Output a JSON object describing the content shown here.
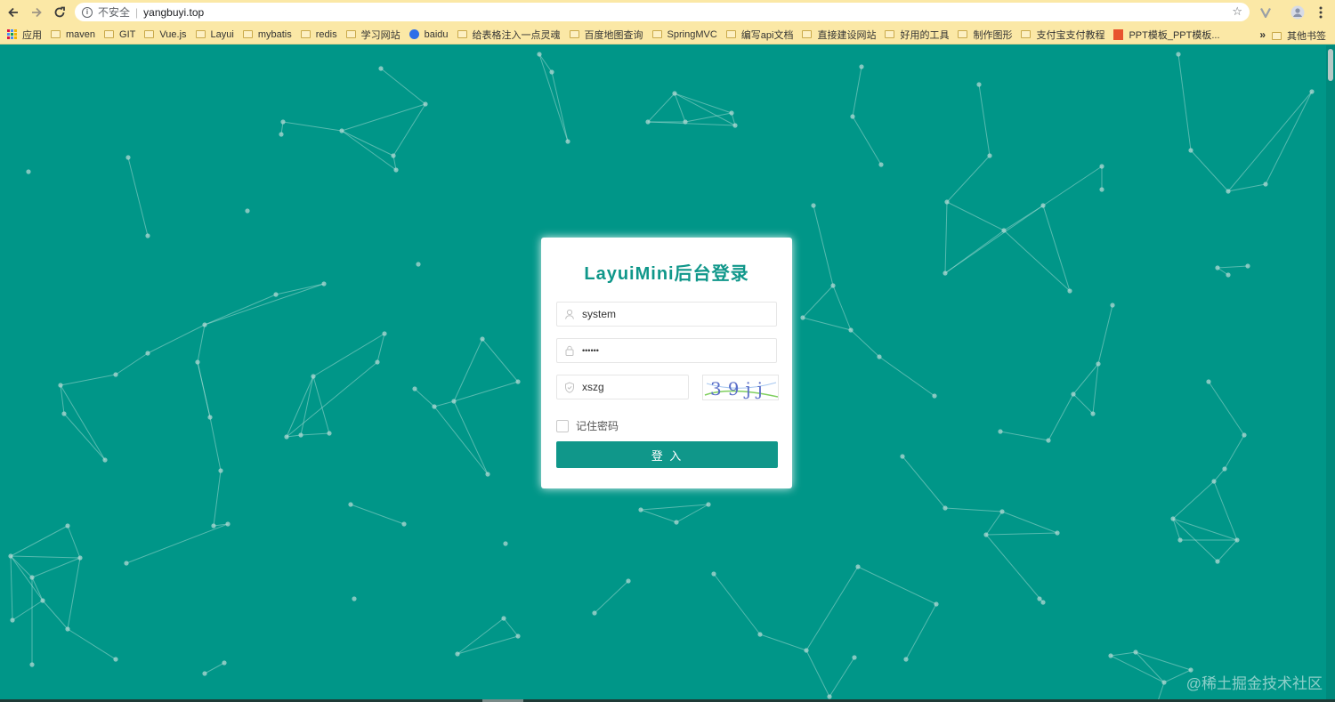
{
  "browser": {
    "security_label": "不安全",
    "url": "yangbuyi.top",
    "bookmarks": [
      {
        "label": "应用",
        "icon": "apps-grid-icon"
      },
      {
        "label": "maven",
        "icon": "folder-icon"
      },
      {
        "label": "GIT",
        "icon": "folder-icon"
      },
      {
        "label": "Vue.js",
        "icon": "folder-icon"
      },
      {
        "label": "Layui",
        "icon": "folder-icon"
      },
      {
        "label": "mybatis",
        "icon": "folder-icon"
      },
      {
        "label": "redis",
        "icon": "folder-icon"
      },
      {
        "label": "学习网站",
        "icon": "folder-icon"
      },
      {
        "label": "baidu",
        "icon": "baidu-paw-icon"
      },
      {
        "label": "给表格注入一点灵魂",
        "icon": "folder-icon"
      },
      {
        "label": "百度地图查询",
        "icon": "folder-icon"
      },
      {
        "label": "SpringMVC",
        "icon": "folder-icon"
      },
      {
        "label": "编写api文档",
        "icon": "folder-icon"
      },
      {
        "label": "直接建设网站",
        "icon": "folder-icon"
      },
      {
        "label": "好用的工具",
        "icon": "folder-icon"
      },
      {
        "label": "制作图形",
        "icon": "folder-icon"
      },
      {
        "label": "支付宝支付教程",
        "icon": "folder-icon"
      },
      {
        "label": "PPT模板_PPT模板...",
        "icon": "ppt-icon"
      }
    ],
    "more_label": "»",
    "other_bookmarks": "其他书签"
  },
  "login": {
    "title": "LayuiMini后台登录",
    "username": "system",
    "password_mask": "••••••",
    "captcha_value": "xszg",
    "captcha_image_text": "39jj",
    "remember_label": "记住密码",
    "remember_checked": false,
    "submit_label": "登 入"
  },
  "watermark": "@稀土掘金技术社区",
  "colors": {
    "background": "#009688",
    "accent": "#10978a",
    "toolbar": "#fbe8a6"
  }
}
